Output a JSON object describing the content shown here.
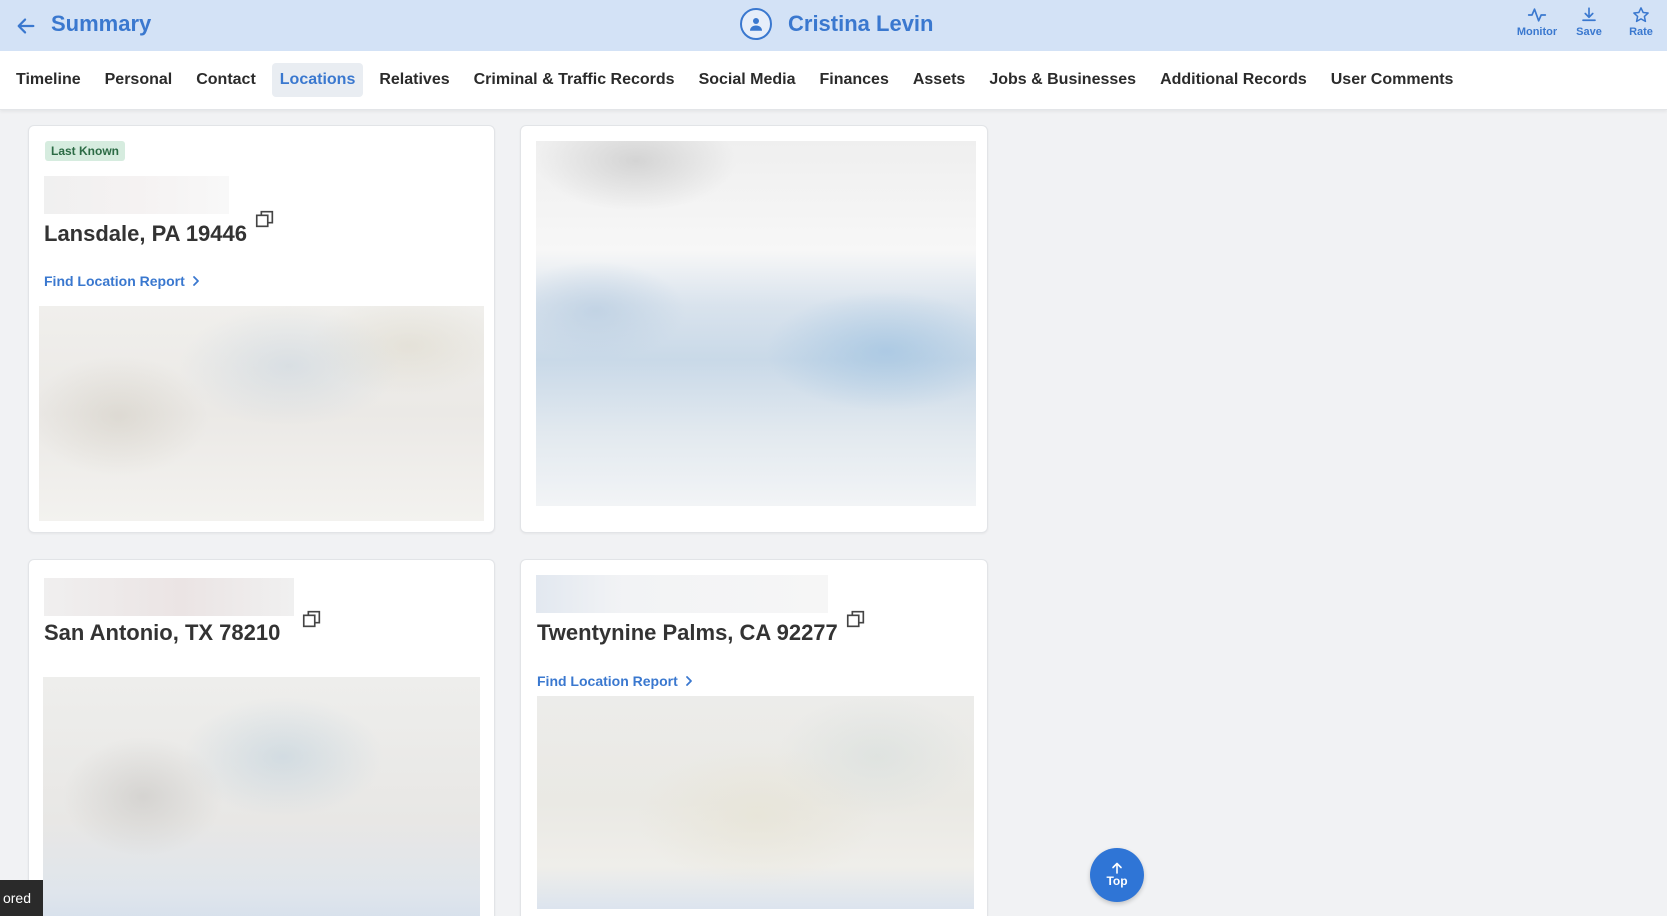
{
  "header": {
    "back_icon": "arrow-left-icon",
    "title": "Summary",
    "person_name": "Cristina Levin",
    "avatar_icon": "person-icon",
    "actions": [
      {
        "label": "Monitor",
        "icon": "activity-icon"
      },
      {
        "label": "Save",
        "icon": "download-icon"
      },
      {
        "label": "Rate",
        "icon": "star-icon"
      }
    ]
  },
  "tabs": [
    {
      "label": "Timeline"
    },
    {
      "label": "Personal"
    },
    {
      "label": "Contact"
    },
    {
      "label": "Locations",
      "active": true
    },
    {
      "label": "Relatives"
    },
    {
      "label": "Criminal & Traffic Records"
    },
    {
      "label": "Social Media"
    },
    {
      "label": "Finances"
    },
    {
      "label": "Assets"
    },
    {
      "label": "Jobs & Businesses"
    },
    {
      "label": "Additional Records"
    },
    {
      "label": "User Comments"
    }
  ],
  "locations": [
    {
      "badge": "Last Known",
      "address": "Lansdale, PA 19446",
      "link": "Find Location Report"
    },
    {
      "address": "San Antonio, TX 78210"
    },
    {
      "address": "Twentynine Palms, CA 92277",
      "link": "Find Location Report"
    }
  ],
  "top_button": {
    "label": "Top",
    "icon": "arrow-up-icon"
  },
  "sponsored_label": "ored",
  "colors": {
    "accent": "#3a78cf",
    "header_bg": "#d3e2f6",
    "badge_bg": "#d6ecdf",
    "badge_text": "#2c6b45"
  }
}
